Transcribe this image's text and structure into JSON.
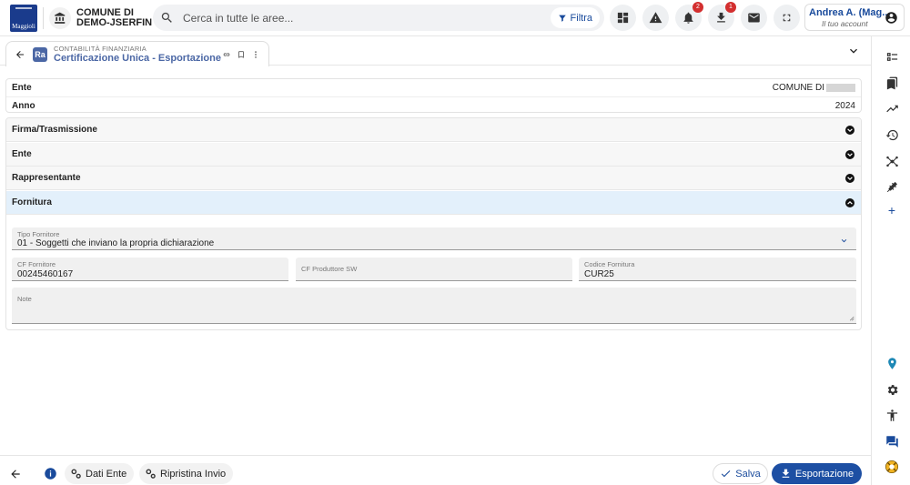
{
  "header": {
    "logo_text": "Maggioli",
    "ente_line1": "COMUNE DI",
    "ente_line2": "DEMO-JSERFIN",
    "search_placeholder": "Cerca in tutte le aree...",
    "filter_label": "Filtra",
    "notifications_count": "2",
    "downloads_count": "1",
    "user_name": "Andrea A. (Mag...",
    "user_sub": "Il tuo account"
  },
  "tab": {
    "module": "CONTABILITÀ FINANZIARIA",
    "title": "Certificazione Unica - Esportazione",
    "icon_text": "Ra"
  },
  "info": {
    "ente_label": "Ente",
    "ente_value": "COMUNE DI",
    "anno_label": "Anno",
    "anno_value": "2024"
  },
  "sections": [
    {
      "label": "Firma/Trasmissione",
      "expanded": false
    },
    {
      "label": "Ente",
      "expanded": false
    },
    {
      "label": "Rappresentante",
      "expanded": false
    },
    {
      "label": "Fornitura",
      "expanded": true
    }
  ],
  "form": {
    "tipo_fornitore_label": "Tipo Fornitore",
    "tipo_fornitore_value": "01 - Soggetti che inviano la propria dichiarazione",
    "cf_fornitore_label": "CF Fornitore",
    "cf_fornitore_value": "00245460167",
    "cf_produttore_label": "CF Produttore SW",
    "cf_produttore_value": "",
    "codice_fornitura_label": "Codice Fornitura",
    "codice_fornitura_value": "CUR25",
    "note_label": "Note",
    "note_value": ""
  },
  "footer": {
    "dati_ente_label": "Dati Ente",
    "ripristina_label": "Ripristina Invio",
    "salva_label": "Salva",
    "export_label": "Esportazione"
  },
  "colors": {
    "primary": "#1d4fa3",
    "title": "#4b67a5",
    "active_section": "#e3f0fb",
    "badge": "#d32f2f"
  }
}
